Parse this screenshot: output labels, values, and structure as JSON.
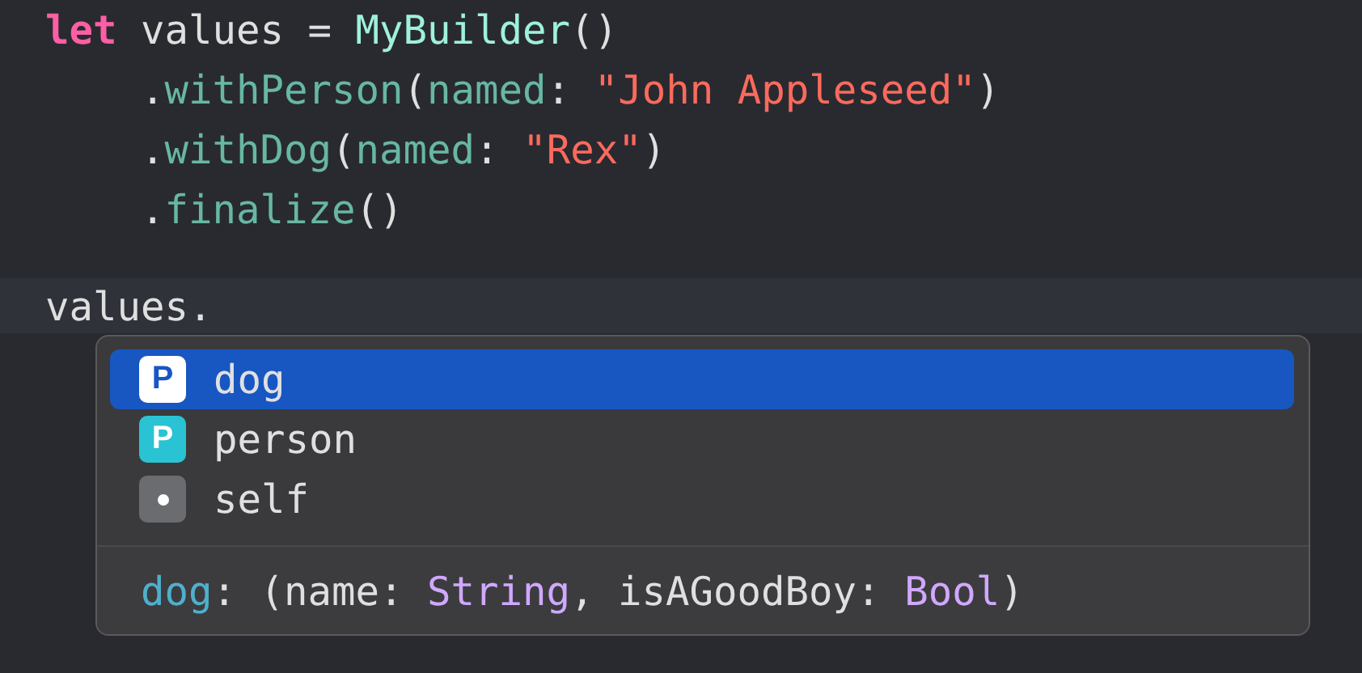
{
  "editor": {
    "lines": [
      {
        "tokens": [
          {
            "kind": "keyword",
            "text": "let"
          },
          {
            "kind": "plain",
            "text": " values = "
          },
          {
            "kind": "type",
            "text": "MyBuilder"
          },
          {
            "kind": "plain",
            "text": "()"
          }
        ]
      },
      {
        "tokens": [
          {
            "kind": "plain",
            "text": "    ."
          },
          {
            "kind": "method",
            "text": "withPerson"
          },
          {
            "kind": "plain",
            "text": "("
          },
          {
            "kind": "method",
            "text": "named"
          },
          {
            "kind": "plain",
            "text": ": "
          },
          {
            "kind": "string",
            "text": "\"John Appleseed\""
          },
          {
            "kind": "plain",
            "text": ")"
          }
        ]
      },
      {
        "tokens": [
          {
            "kind": "plain",
            "text": "    ."
          },
          {
            "kind": "method",
            "text": "withDog"
          },
          {
            "kind": "plain",
            "text": "("
          },
          {
            "kind": "method",
            "text": "named"
          },
          {
            "kind": "plain",
            "text": ": "
          },
          {
            "kind": "string",
            "text": "\"Rex\""
          },
          {
            "kind": "plain",
            "text": ")"
          }
        ]
      },
      {
        "tokens": [
          {
            "kind": "plain",
            "text": "    ."
          },
          {
            "kind": "method",
            "text": "finalize"
          },
          {
            "kind": "plain",
            "text": "()"
          }
        ]
      }
    ],
    "current_line": {
      "text": "values."
    }
  },
  "completion": {
    "items": [
      {
        "kind": "property",
        "badge": "P",
        "label": "dog",
        "selected": true
      },
      {
        "kind": "property",
        "badge": "P",
        "label": "person",
        "selected": false
      },
      {
        "kind": "value",
        "label": "self",
        "selected": false
      }
    ],
    "signature": [
      {
        "kind": "name",
        "text": "dog"
      },
      {
        "kind": "plain",
        "text": ": (name: "
      },
      {
        "kind": "type",
        "text": "String"
      },
      {
        "kind": "plain",
        "text": ", isAGoodBoy: "
      },
      {
        "kind": "type",
        "text": "Bool"
      },
      {
        "kind": "plain",
        "text": ")"
      }
    ]
  }
}
